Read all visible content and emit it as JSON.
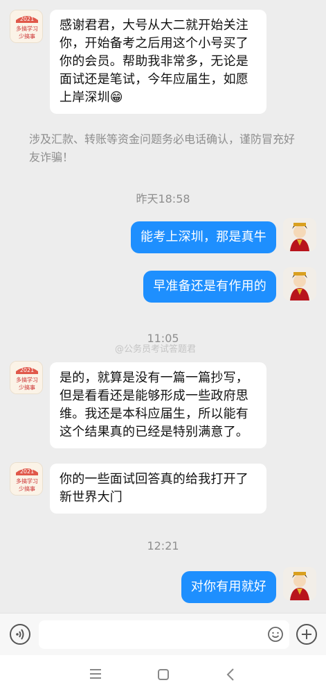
{
  "messages": [
    {
      "side": "left",
      "text": "感谢君君，大号从大二就开始关注你，开始备考之后用这个小号买了你的会员。帮助我非常多，无论是面试还是笔试，今年应届生，如愿上岸深圳😁"
    },
    {
      "side": "right",
      "text": "能考上深圳，那是真牛"
    },
    {
      "side": "right",
      "text": "早准备还是有作用的"
    },
    {
      "side": "left",
      "text": "是的，就算是没有一篇一篇抄写，但是看看还是能够形成一些政府思维。我还是本科应届生，所以能有这个结果真的已经是特别满意了。"
    },
    {
      "side": "left",
      "text": "你的一些面试回答真的给我打开了新世界大门"
    },
    {
      "side": "right",
      "text": "对你有用就好"
    }
  ],
  "notice": "涉及汇款、转账等资金问题务必电话确认，谨防冒充好友诈骗！",
  "timestamps": [
    "昨天18:58",
    "11:05",
    "12:21"
  ],
  "watermark": "@公务员考试答题君",
  "left_avatar": {
    "year": "2021",
    "line1": "多搞学习",
    "line2": "少搞事"
  },
  "colors": {
    "background": "#ededed",
    "bubble_right": "#1e8ffe",
    "bubble_left": "#ffffff"
  },
  "input_bar": {
    "voice_icon": "voice-icon",
    "emoji_icon": "emoji-icon",
    "plus_icon": "plus-icon"
  },
  "nav": {
    "menu_icon": "menu-icon",
    "home_icon": "home-square-icon",
    "back_icon": "back-chevron-icon"
  }
}
